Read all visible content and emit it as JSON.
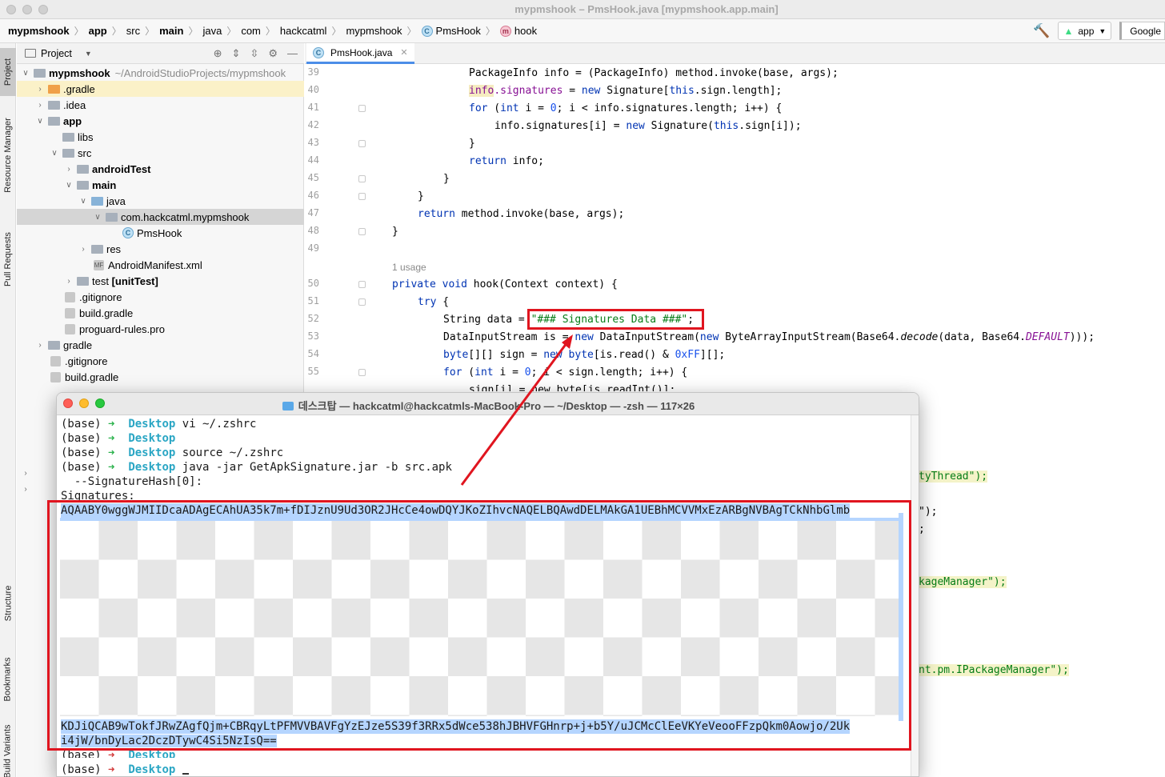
{
  "window": {
    "title": "mypmshook – PmsHook.java [mypmshook.app.main]"
  },
  "breadcrumb": {
    "items": [
      "mypmshook",
      "app",
      "src",
      "main",
      "java",
      "com",
      "hackcatml",
      "mypmshook",
      "PmsHook",
      "hook"
    ]
  },
  "toolbar": {
    "run_config": "app",
    "device": "Google"
  },
  "left_tabs": {
    "project": "Project",
    "resource_manager": "Resource Manager",
    "pull_requests": "Pull Requests",
    "structure": "Structure",
    "bookmarks": "Bookmarks",
    "build_variants": "Build Variants"
  },
  "project_panel": {
    "title": "Project",
    "tree": [
      {
        "label": "mypmshook",
        "path": "~/AndroidStudioProjects/mypmshook"
      },
      {
        "label": ".gradle"
      },
      {
        "label": ".idea"
      },
      {
        "label": "app"
      },
      {
        "label": "libs"
      },
      {
        "label": "src"
      },
      {
        "label": "androidTest"
      },
      {
        "label": "main"
      },
      {
        "label": "java"
      },
      {
        "label": "com.hackcatml.mypmshook"
      },
      {
        "label": "PmsHook"
      },
      {
        "label": "res"
      },
      {
        "label": "AndroidManifest.xml"
      },
      {
        "label": "test",
        "suffix": "[unitTest]"
      },
      {
        "label": ".gitignore"
      },
      {
        "label": "build.gradle"
      },
      {
        "label": "proguard-rules.pro"
      },
      {
        "label": "gradle"
      },
      {
        "label": ".gitignore"
      },
      {
        "label": "build.gradle"
      }
    ]
  },
  "editor": {
    "tab": "PmsHook.java",
    "line_numbers": [
      "39",
      "40",
      "41",
      "42",
      "43",
      "44",
      "45",
      "46",
      "47",
      "48",
      "49",
      "50",
      "51",
      "52",
      "53",
      "54",
      "55"
    ],
    "usage_hint": "1 usage",
    "code": {
      "l39": "PackageInfo info = (PackageInfo) method.invoke(base, args);",
      "l40_a": "info",
      "l40_b": ".signatures",
      "l40_c": " = ",
      "l40_d": "new",
      "l40_e": " Signature[",
      "l40_f": "this",
      "l40_g": ".sign.length];",
      "l41_a": "for",
      "l41_b": " (",
      "l41_c": "int",
      "l41_d": " i = ",
      "l41_e": "0",
      "l41_f": "; i < info.signatures.length; i++) {",
      "l42_a": "info.signatures[i] = ",
      "l42_b": "new",
      "l42_c": " Signature(",
      "l42_d": "this",
      "l42_e": ".sign[i]);",
      "l43": "}",
      "l44_a": "return",
      "l44_b": " info;",
      "l45": "}",
      "l46": "}",
      "l47_a": "return",
      "l47_b": " method.invoke(base, args);",
      "l48": "}",
      "l50_a": "private",
      "l50_b": " ",
      "l50_c": "void",
      "l50_d": " hook(Context context) {",
      "l51_a": "try",
      "l51_b": " {",
      "l52_a": "String data = ",
      "l52_b": "\"### Signatures Data ###\"",
      "l52_c": ";",
      "l53_a": "DataInputStream is = ",
      "l53_b": "new",
      "l53_c": " DataInputStream(",
      "l53_d": "new",
      "l53_e": " ByteArrayInputStream(Base64.",
      "l53_f": "decode",
      "l53_g": "(data, Base64.",
      "l53_h": "DEFAULT",
      "l53_i": ")));",
      "l54_a": "byte",
      "l54_b": "[][] sign = ",
      "l54_c": "new",
      "l54_d": " ",
      "l54_e": "byte",
      "l54_f": "[is.read() & ",
      "l54_g": "0xFF",
      "l54_h": "][];",
      "l55_a": "for",
      "l55_b": " (",
      "l55_c": "int",
      "l55_d": " i = ",
      "l55_e": "0",
      "l55_f": "; i < sign.length; i++) {",
      "l56": "sign[i] = new byte[is.readInt()];"
    },
    "right_fragments": [
      "tyThread\");",
      "\");",
      ";",
      "kageManager\");",
      "nt.pm.IPackageManager\");"
    ]
  },
  "terminal": {
    "title": "데스크탑 — hackcatml@hackcatmls-MacBook-Pro — ~/Desktop — -zsh — 117×26",
    "prompt_env": "(base)",
    "arrow": "➜",
    "dir": "Desktop",
    "cmd1": "vi ~/.zshrc",
    "cmd3": "source ~/.zshrc",
    "cmd4": "java -jar GetApkSignature.jar -b src.apk",
    "hash_label": "  --SignatureHash[0]:",
    "sig_label": "Signatures:",
    "sig_first": "AQAABY0wggWJMIIDcaADAgECAhUA35k7m+fDIJznU9Ud3OR2JHcCe4owDQYJKoZIhvcNAQELBQAwdDELMAkGA1UEBhMCVVMxEzARBgNVBAgTCkNhbGlmb",
    "sig_last1": "KDJiQCAB9wTokfJRwZAgfQjm+CBRqyLtPFMVVBAVFgYzEJze5S39f3RRx5dWce538hJBHVFGHnrp+j+b5Y/uJCMcClEeVKYeVeooFFzpQkm0Aowjo/2Uk",
    "sig_last2": "i4jW/bnDyLac2DczDTywC4Si5NzIsQ=="
  }
}
